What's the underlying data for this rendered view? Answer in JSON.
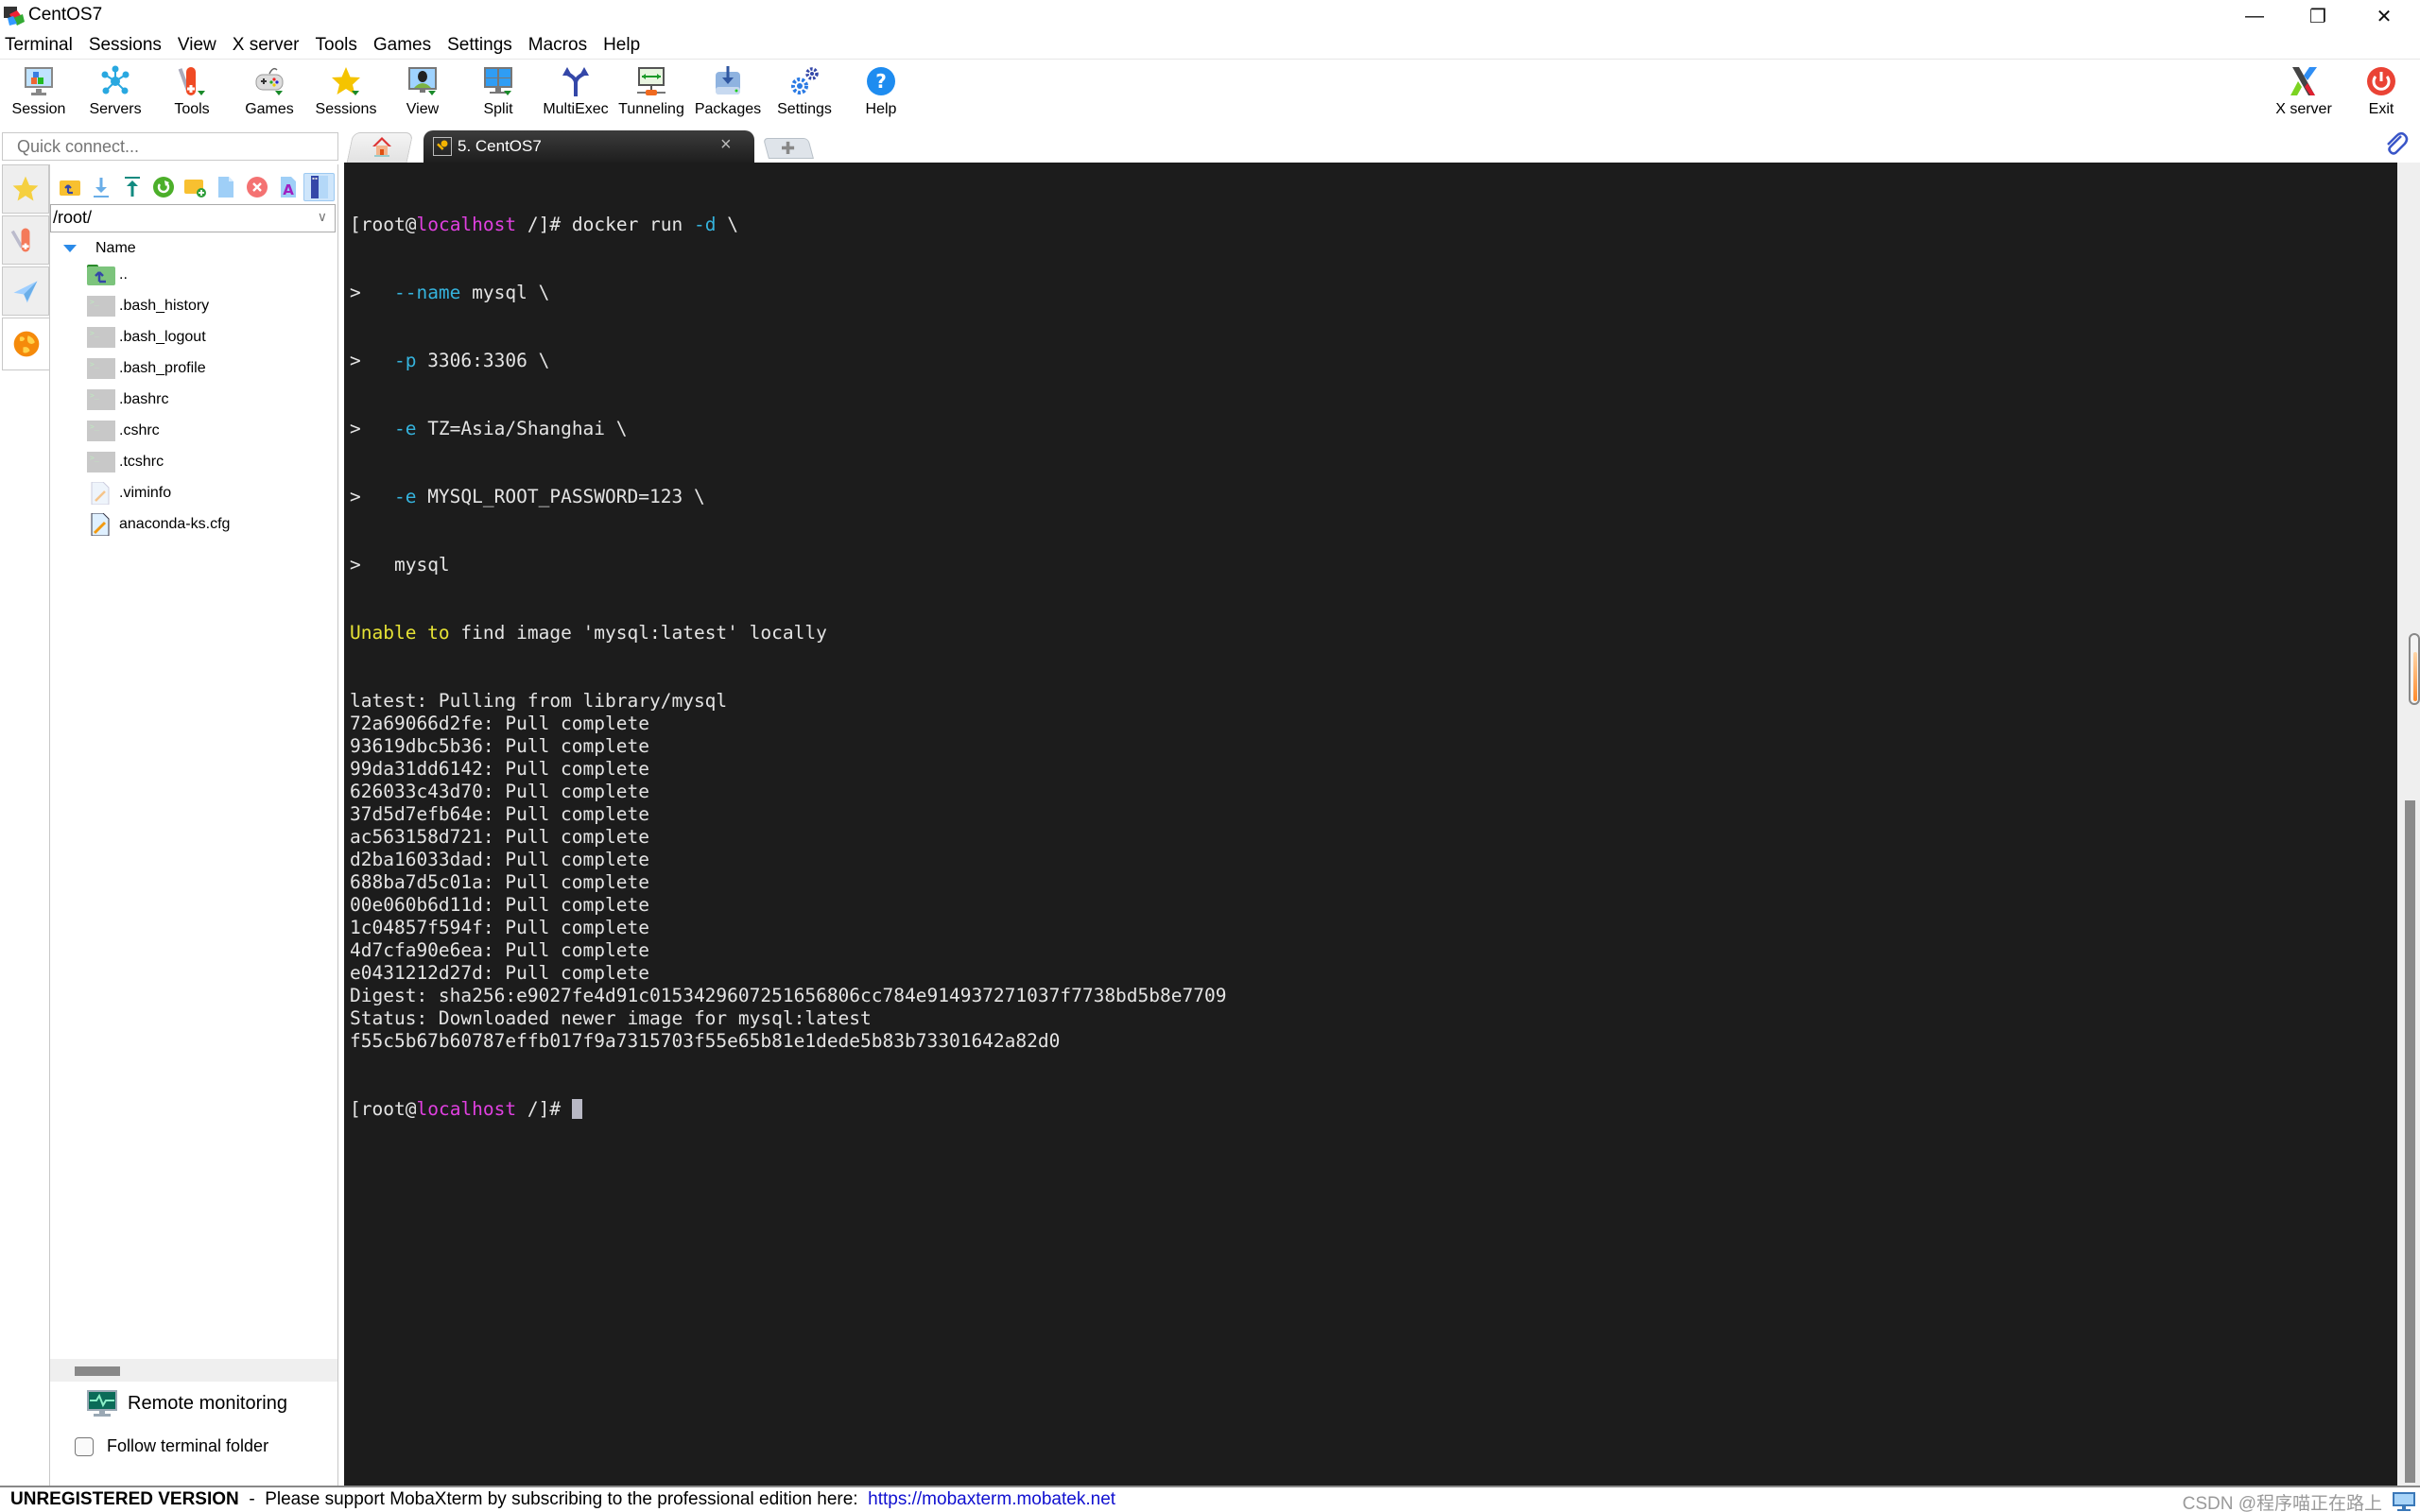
{
  "window": {
    "title": "CentOS7",
    "controls": {
      "minimize": "—",
      "maximize": "❐",
      "close": "✕"
    }
  },
  "menu": [
    "Terminal",
    "Sessions",
    "View",
    "X server",
    "Tools",
    "Games",
    "Settings",
    "Macros",
    "Help"
  ],
  "toolbar": {
    "left": [
      {
        "label": "Session",
        "icon": "session-monitor-icon"
      },
      {
        "label": "Servers",
        "icon": "servers-network-icon"
      },
      {
        "label": "Tools",
        "icon": "tools-knife-icon"
      },
      {
        "label": "Games",
        "icon": "gamepad-icon"
      },
      {
        "label": "Sessions",
        "icon": "star-icon"
      },
      {
        "label": "View",
        "icon": "view-user-icon"
      },
      {
        "label": "Split",
        "icon": "split-window-icon"
      },
      {
        "label": "MultiExec",
        "icon": "fork-arrows-icon"
      },
      {
        "label": "Tunneling",
        "icon": "tunnel-icon"
      },
      {
        "label": "Packages",
        "icon": "packages-download-icon"
      },
      {
        "label": "Settings",
        "icon": "gears-icon"
      },
      {
        "label": "Help",
        "icon": "help-icon"
      }
    ],
    "right": [
      {
        "label": "X server",
        "icon": "x-server-icon"
      },
      {
        "label": "Exit",
        "icon": "power-icon"
      }
    ]
  },
  "quick_connect": {
    "placeholder": "Quick connect..."
  },
  "tabs": {
    "active_label": "5. CentOS7",
    "close_glyph": "×",
    "new_glyph": "✚"
  },
  "file_browser": {
    "path": "/root/",
    "column_header": "Name",
    "files": [
      {
        "name": "..",
        "type": "parent-folder"
      },
      {
        "name": ".bash_history",
        "type": "shell-file"
      },
      {
        "name": ".bash_logout",
        "type": "shell-file"
      },
      {
        "name": ".bash_profile",
        "type": "shell-file"
      },
      {
        "name": ".bashrc",
        "type": "shell-file"
      },
      {
        "name": ".cshrc",
        "type": "shell-file"
      },
      {
        "name": ".tcshrc",
        "type": "shell-file"
      },
      {
        "name": ".viminfo",
        "type": "text-file"
      },
      {
        "name": "anaconda-ks.cfg",
        "type": "config-file"
      }
    ],
    "remote_monitoring": "Remote monitoring",
    "follow_terminal_folder": {
      "label": "Follow terminal folder",
      "checked": false
    }
  },
  "terminal": {
    "prompt": {
      "user": "root",
      "host": "localhost",
      "cwd": "/"
    },
    "command_lines": [
      {
        "prefix": "",
        "opt": "",
        "text": " docker run ",
        "opt2": "-d",
        "tail": " \\"
      },
      {
        "prefix": ">   ",
        "opt": "--name",
        "text": " mysql \\",
        "opt2": "",
        "tail": ""
      },
      {
        "prefix": ">   ",
        "opt": "-p",
        "text": " 3306:3306 \\",
        "opt2": "",
        "tail": ""
      },
      {
        "prefix": ">   ",
        "opt": "-e",
        "text": " TZ=Asia/Shanghai \\",
        "opt2": "",
        "tail": ""
      },
      {
        "prefix": ">   ",
        "opt": "-e",
        "text": " MYSQL_ROOT_PASSWORD=123 \\",
        "opt2": "",
        "tail": ""
      },
      {
        "prefix": ">   ",
        "opt": "",
        "text": "mysql",
        "opt2": "",
        "tail": ""
      }
    ],
    "warning": {
      "highlight": "Unable to",
      "rest": " find image 'mysql:latest' locally"
    },
    "output_lines": [
      "latest: Pulling from library/mysql",
      "72a69066d2fe: Pull complete",
      "93619dbc5b36: Pull complete",
      "99da31dd6142: Pull complete",
      "626033c43d70: Pull complete",
      "37d5d7efb64e: Pull complete",
      "ac563158d721: Pull complete",
      "d2ba16033dad: Pull complete",
      "688ba7d5c01a: Pull complete",
      "00e060b6d11d: Pull complete",
      "1c04857f594f: Pull complete",
      "4d7cfa90e6ea: Pull complete",
      "e0431212d27d: Pull complete",
      "Digest: sha256:e9027fe4d91c0153429607251656806cc784e914937271037f7738bd5b8e7709",
      "Status: Downloaded newer image for mysql:latest",
      "f55c5b67b60787effb017f9a7315703f55e65b81e1dede5b83b73301642a82d0"
    ]
  },
  "statusbar": {
    "unregistered": "UNREGISTERED VERSION",
    "separator": "  -  ",
    "message": "Please support MobaXterm by subscribing to the professional edition here:  ",
    "link": "https://mobaxterm.mobatek.net",
    "watermark": "CSDN @程序喵正在路上"
  },
  "colors": {
    "terminal_bg": "#1c1c1c",
    "terminal_fg": "#e4e4e4",
    "host": "#e040e0",
    "option": "#35b3dd",
    "warning": "#e6e235",
    "link": "#1010d0"
  }
}
